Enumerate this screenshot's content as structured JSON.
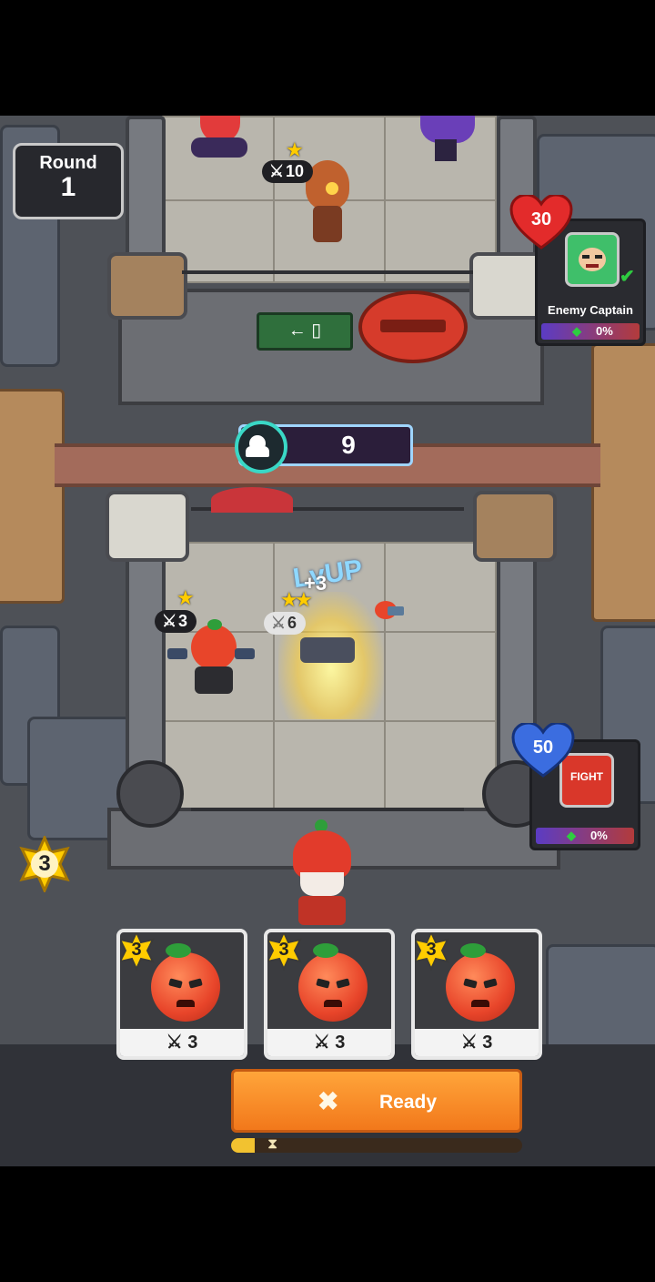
{
  "hud": {
    "round_label": "Round",
    "round_number": "1",
    "crowd_count": "9",
    "coins": "3"
  },
  "enemy": {
    "hp": "30",
    "name": "Enemy Captain",
    "progress": "0%",
    "avatar_icon": "angry-green-face-icon",
    "ready_check_icon": "check-icon"
  },
  "player": {
    "hp": "50",
    "progress": "0%",
    "avatar_icon": "fight-sign-icon",
    "avatar_text": "FIGHT"
  },
  "board_units": [
    {
      "id": "enemy-unit",
      "stars": 1,
      "power": "10",
      "theme": "dark"
    },
    {
      "id": "player-unit-left",
      "stars": 1,
      "power": "3",
      "theme": "dark"
    },
    {
      "id": "player-unit-merged",
      "stars": 2,
      "power": "6",
      "theme": "light"
    }
  ],
  "effects": {
    "level_up_text": "LvUP",
    "level_up_bonus": "+3"
  },
  "shop_cards": [
    {
      "cost": "3",
      "power": "3"
    },
    {
      "cost": "3",
      "power": "3"
    },
    {
      "cost": "3",
      "power": "3"
    }
  ],
  "ready_button": {
    "label": "Ready",
    "icon": "crossed-swords-icon"
  },
  "timer": {
    "progress": 0.08
  },
  "colors": {
    "ready": "#f2781b",
    "enemy_heart": "#e32b2b",
    "player_heart": "#3b6de0",
    "coin": "#ffcc00"
  }
}
